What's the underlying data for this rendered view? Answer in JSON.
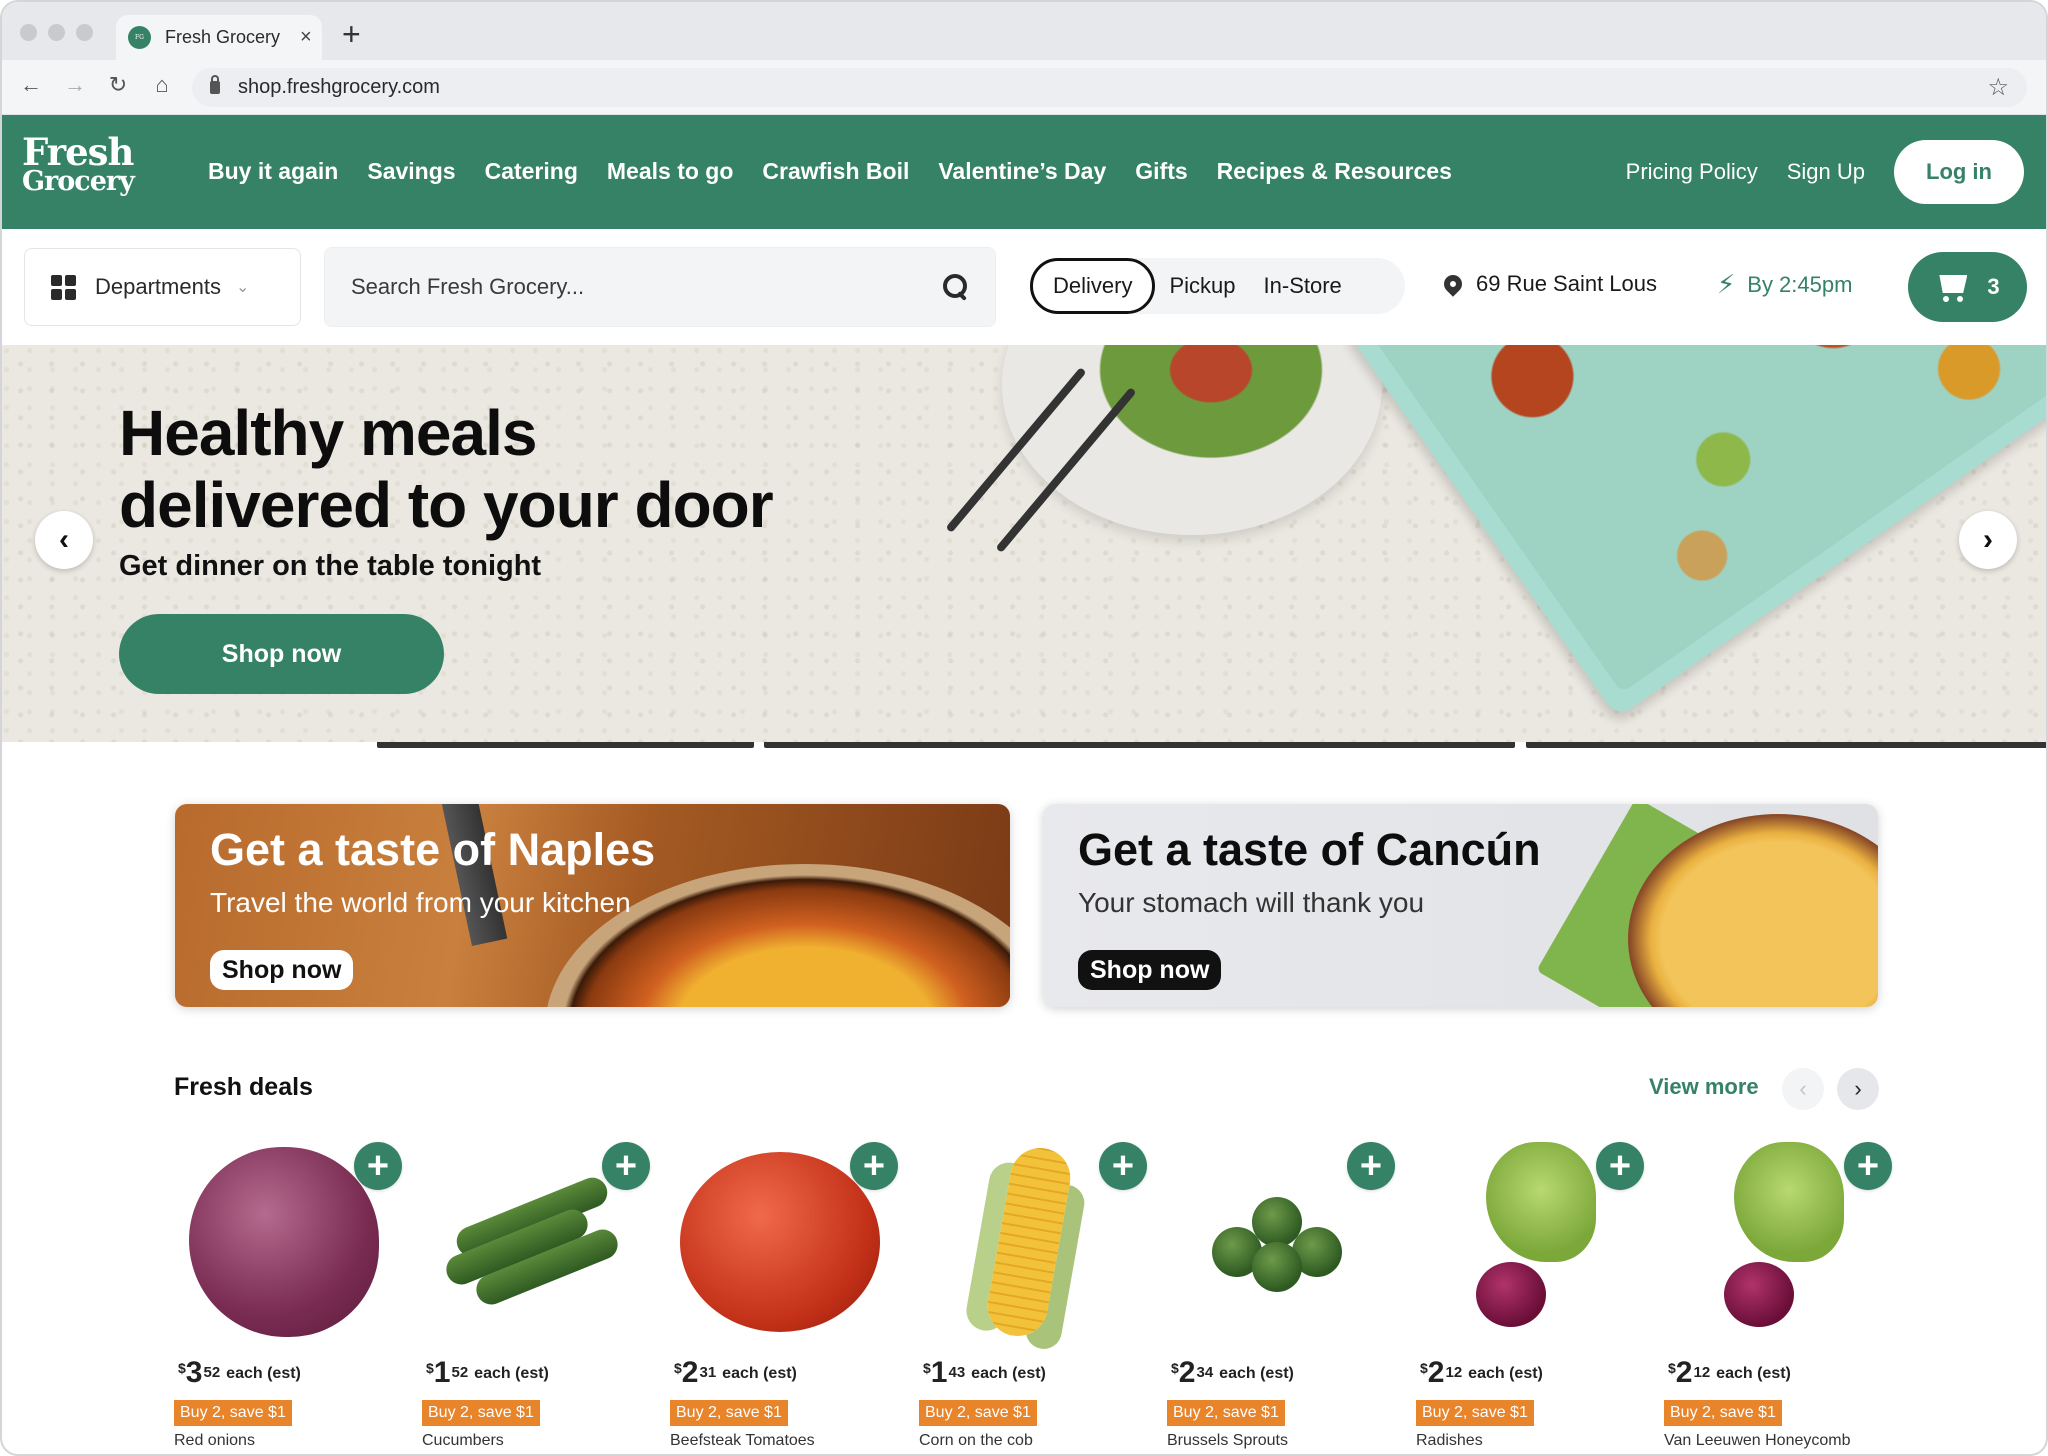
{
  "browser": {
    "tab_title": "Fresh Grocery",
    "tab_close_icon": "×",
    "new_tab_icon": "+",
    "url": "shop.freshgrocery.com",
    "back_icon": "←",
    "forward_icon": "→",
    "reload_icon": "↻",
    "home_icon": "⌂",
    "star_icon": "☆",
    "favicon_text": "Fresh Grocery"
  },
  "header": {
    "logo_line1": "Fresh",
    "logo_line2": "Grocery",
    "nav": [
      "Buy it again",
      "Savings",
      "Catering",
      "Meals to go",
      "Crawfish Boil",
      "Valentine’s Day",
      "Gifts",
      "Recipes & Resources"
    ],
    "pricing_policy": "Pricing Policy",
    "sign_up": "Sign Up",
    "log_in": "Log in",
    "brand_color": "#358267"
  },
  "subbar": {
    "departments_label": "Departments",
    "search_placeholder": "Search Fresh Grocery...",
    "search_value": "",
    "fulfillment_options": [
      "Delivery",
      "Pickup",
      "In-Store"
    ],
    "fulfillment_selected": "Delivery",
    "address": "69 Rue Saint Lous",
    "eta": "By 2:45pm",
    "cart_count": "3"
  },
  "hero": {
    "title_line1": "Healthy meals",
    "title_line2": "delivered to your door",
    "subtitle": "Get dinner on the table tonight",
    "cta": "Shop now",
    "prev_icon": "‹",
    "next_icon": "›",
    "slide_count": 3
  },
  "promos": [
    {
      "title": "Get a taste of Naples",
      "subtitle": "Travel the world from your kitchen",
      "cta": "Shop now"
    },
    {
      "title": "Get a taste of Cancún",
      "subtitle": "Your stomach will thank you",
      "cta": "Shop now"
    }
  ],
  "deals": {
    "title": "Fresh deals",
    "view_more": "View more",
    "prev_icon": "‹",
    "next_icon": "›",
    "add_icon": "+",
    "products": [
      {
        "name": "Red onions",
        "currency": "$",
        "dollars": "3",
        "cents": "52",
        "unit": "each (est)",
        "badge": "Buy 2, save $1",
        "image": "red-onion"
      },
      {
        "name": "Cucumbers",
        "currency": "$",
        "dollars": "1",
        "cents": "52",
        "unit": "each (est)",
        "badge": "Buy 2, save $1",
        "image": "cucumber"
      },
      {
        "name": "Beefsteak Tomatoes",
        "currency": "$",
        "dollars": "2",
        "cents": "31",
        "unit": "each (est)",
        "badge": "Buy 2, save $1",
        "image": "tomato"
      },
      {
        "name": "Corn on the cob",
        "currency": "$",
        "dollars": "1",
        "cents": "43",
        "unit": "each (est)",
        "badge": "Buy 2, save $1",
        "image": "corn"
      },
      {
        "name": "Brussels Sprouts",
        "currency": "$",
        "dollars": "2",
        "cents": "34",
        "unit": "each (est)",
        "badge": "Buy 2, save $1",
        "image": "brussels-sprouts"
      },
      {
        "name": "Radishes",
        "currency": "$",
        "dollars": "2",
        "cents": "12",
        "unit": "each (est)",
        "badge": "Buy 2, save $1",
        "image": "radish"
      },
      {
        "name": "Van Leeuwen Honeycomb",
        "currency": "$",
        "dollars": "2",
        "cents": "12",
        "unit": "each (est)",
        "badge": "Buy 2, save $1",
        "image": "radish"
      }
    ],
    "badge_color": "#e8842a"
  }
}
